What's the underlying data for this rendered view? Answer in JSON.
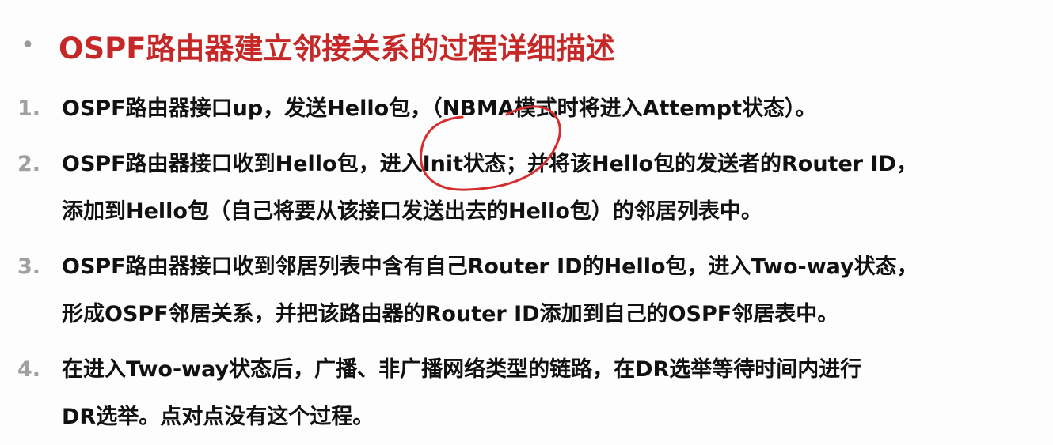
{
  "slide": {
    "bullet": "•",
    "title": "OSPF路由器建立邻接关系的过程详细描述"
  },
  "steps": [
    {
      "number": "1.",
      "lines": [
        "OSPF路由器接口up，发送Hello包，（NBMA模式时将进入Attempt状态）。"
      ]
    },
    {
      "number": "2.",
      "lines": [
        "OSPF路由器接口收到Hello包，进入Init状态；并将该Hello包的发送者的Router ID，",
        "添加到Hello包（自己将要从该接口发送出去的Hello包）的邻居列表中。"
      ]
    },
    {
      "number": "3.",
      "lines": [
        "OSPF路由器接口收到邻居列表中含有自己Router ID的Hello包，进入Two-way状态，",
        "形成OSPF邻居关系，并把该路由器的Router ID添加到自己的OSPF邻居表中。"
      ]
    },
    {
      "number": "4.",
      "lines": [
        "在进入Two-way状态后，广播、非广播网络类型的链路，在DR选举等待时间内进行",
        "DR选举。点对点没有这个过程。"
      ]
    }
  ],
  "colors": {
    "title": "#c62828",
    "numbers": "#a0a0a0",
    "text": "#111111",
    "annotation": "#d32f2f"
  }
}
